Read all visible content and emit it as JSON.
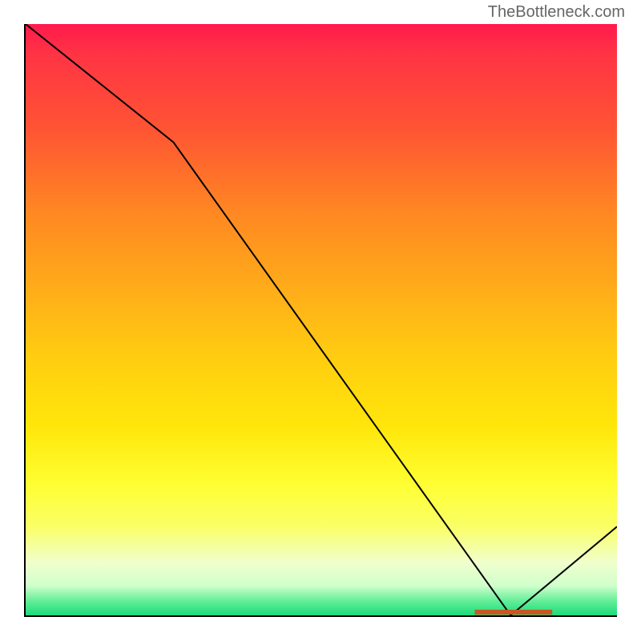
{
  "watermark": "TheBottleneck.com",
  "chart_data": {
    "type": "line",
    "title": "",
    "xlabel": "",
    "ylabel": "",
    "xlim": [
      0,
      100
    ],
    "ylim": [
      0,
      100
    ],
    "x": [
      0,
      25,
      82,
      100
    ],
    "values": [
      100,
      80,
      0,
      15
    ],
    "highlight_range_x": [
      76,
      89
    ],
    "gradient": "red-yellow-green",
    "grid": false,
    "legend": false
  }
}
